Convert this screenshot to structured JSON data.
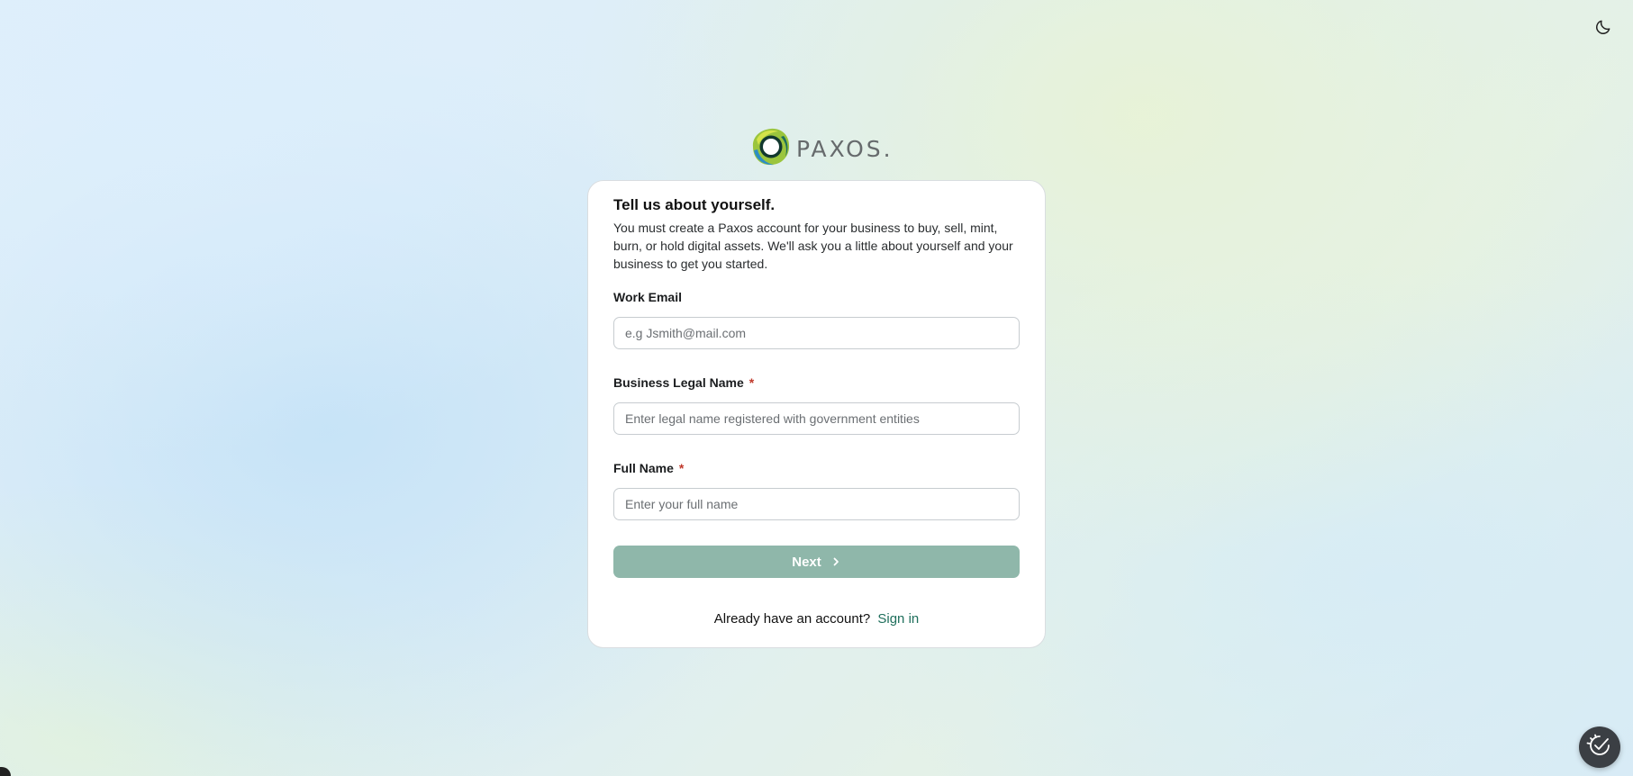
{
  "header": {
    "theme_toggle_icon": "moon-icon"
  },
  "logo": {
    "wordmark": "PAXOS."
  },
  "card": {
    "title": "Tell us about yourself.",
    "intro": "You must create a Paxos account for your business to buy, sell, mint, burn, or hold digital assets. We'll ask you a little about yourself and your business to get you started."
  },
  "form": {
    "email": {
      "label": "Work Email",
      "placeholder": "e.g Jsmith@mail.com",
      "value": ""
    },
    "business_name": {
      "label": "Business Legal Name",
      "required_marker": "*",
      "placeholder": "Enter legal name registered with government entities",
      "value": ""
    },
    "full_name": {
      "label": "Full Name",
      "required_marker": "*",
      "placeholder": "Enter your full name",
      "value": ""
    },
    "next_label": "Next",
    "next_icon": "chevron-right-icon"
  },
  "signin": {
    "prompt": "Already have an account?",
    "link_label": "Sign in"
  },
  "help": {
    "icon": "help-check-icon"
  },
  "colors": {
    "accent": "#1f6f5c",
    "button_disabled": "#8fb7aa",
    "required": "#c0392b"
  }
}
